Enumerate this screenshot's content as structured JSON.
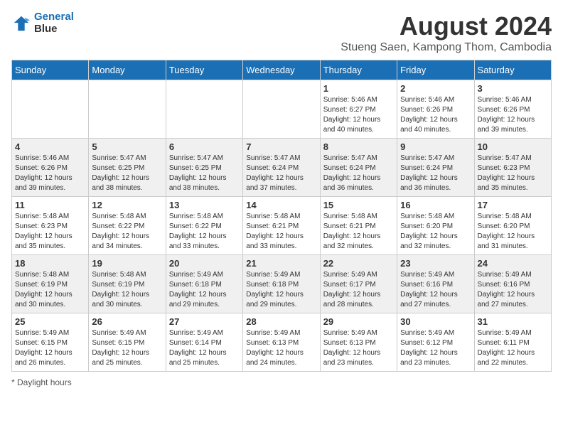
{
  "header": {
    "logo_line1": "General",
    "logo_line2": "Blue",
    "main_title": "August 2024",
    "subtitle": "Stueng Saen, Kampong Thom, Cambodia"
  },
  "days_of_week": [
    "Sunday",
    "Monday",
    "Tuesday",
    "Wednesday",
    "Thursday",
    "Friday",
    "Saturday"
  ],
  "weeks": [
    [
      {
        "day": "",
        "info": ""
      },
      {
        "day": "",
        "info": ""
      },
      {
        "day": "",
        "info": ""
      },
      {
        "day": "",
        "info": ""
      },
      {
        "day": "1",
        "info": "Sunrise: 5:46 AM\nSunset: 6:27 PM\nDaylight: 12 hours and 40 minutes."
      },
      {
        "day": "2",
        "info": "Sunrise: 5:46 AM\nSunset: 6:26 PM\nDaylight: 12 hours and 40 minutes."
      },
      {
        "day": "3",
        "info": "Sunrise: 5:46 AM\nSunset: 6:26 PM\nDaylight: 12 hours and 39 minutes."
      }
    ],
    [
      {
        "day": "4",
        "info": "Sunrise: 5:46 AM\nSunset: 6:26 PM\nDaylight: 12 hours and 39 minutes."
      },
      {
        "day": "5",
        "info": "Sunrise: 5:47 AM\nSunset: 6:25 PM\nDaylight: 12 hours and 38 minutes."
      },
      {
        "day": "6",
        "info": "Sunrise: 5:47 AM\nSunset: 6:25 PM\nDaylight: 12 hours and 38 minutes."
      },
      {
        "day": "7",
        "info": "Sunrise: 5:47 AM\nSunset: 6:24 PM\nDaylight: 12 hours and 37 minutes."
      },
      {
        "day": "8",
        "info": "Sunrise: 5:47 AM\nSunset: 6:24 PM\nDaylight: 12 hours and 36 minutes."
      },
      {
        "day": "9",
        "info": "Sunrise: 5:47 AM\nSunset: 6:24 PM\nDaylight: 12 hours and 36 minutes."
      },
      {
        "day": "10",
        "info": "Sunrise: 5:47 AM\nSunset: 6:23 PM\nDaylight: 12 hours and 35 minutes."
      }
    ],
    [
      {
        "day": "11",
        "info": "Sunrise: 5:48 AM\nSunset: 6:23 PM\nDaylight: 12 hours and 35 minutes."
      },
      {
        "day": "12",
        "info": "Sunrise: 5:48 AM\nSunset: 6:22 PM\nDaylight: 12 hours and 34 minutes."
      },
      {
        "day": "13",
        "info": "Sunrise: 5:48 AM\nSunset: 6:22 PM\nDaylight: 12 hours and 33 minutes."
      },
      {
        "day": "14",
        "info": "Sunrise: 5:48 AM\nSunset: 6:21 PM\nDaylight: 12 hours and 33 minutes."
      },
      {
        "day": "15",
        "info": "Sunrise: 5:48 AM\nSunset: 6:21 PM\nDaylight: 12 hours and 32 minutes."
      },
      {
        "day": "16",
        "info": "Sunrise: 5:48 AM\nSunset: 6:20 PM\nDaylight: 12 hours and 32 minutes."
      },
      {
        "day": "17",
        "info": "Sunrise: 5:48 AM\nSunset: 6:20 PM\nDaylight: 12 hours and 31 minutes."
      }
    ],
    [
      {
        "day": "18",
        "info": "Sunrise: 5:48 AM\nSunset: 6:19 PM\nDaylight: 12 hours and 30 minutes."
      },
      {
        "day": "19",
        "info": "Sunrise: 5:48 AM\nSunset: 6:19 PM\nDaylight: 12 hours and 30 minutes."
      },
      {
        "day": "20",
        "info": "Sunrise: 5:49 AM\nSunset: 6:18 PM\nDaylight: 12 hours and 29 minutes."
      },
      {
        "day": "21",
        "info": "Sunrise: 5:49 AM\nSunset: 6:18 PM\nDaylight: 12 hours and 29 minutes."
      },
      {
        "day": "22",
        "info": "Sunrise: 5:49 AM\nSunset: 6:17 PM\nDaylight: 12 hours and 28 minutes."
      },
      {
        "day": "23",
        "info": "Sunrise: 5:49 AM\nSunset: 6:16 PM\nDaylight: 12 hours and 27 minutes."
      },
      {
        "day": "24",
        "info": "Sunrise: 5:49 AM\nSunset: 6:16 PM\nDaylight: 12 hours and 27 minutes."
      }
    ],
    [
      {
        "day": "25",
        "info": "Sunrise: 5:49 AM\nSunset: 6:15 PM\nDaylight: 12 hours and 26 minutes."
      },
      {
        "day": "26",
        "info": "Sunrise: 5:49 AM\nSunset: 6:15 PM\nDaylight: 12 hours and 25 minutes."
      },
      {
        "day": "27",
        "info": "Sunrise: 5:49 AM\nSunset: 6:14 PM\nDaylight: 12 hours and 25 minutes."
      },
      {
        "day": "28",
        "info": "Sunrise: 5:49 AM\nSunset: 6:13 PM\nDaylight: 12 hours and 24 minutes."
      },
      {
        "day": "29",
        "info": "Sunrise: 5:49 AM\nSunset: 6:13 PM\nDaylight: 12 hours and 23 minutes."
      },
      {
        "day": "30",
        "info": "Sunrise: 5:49 AM\nSunset: 6:12 PM\nDaylight: 12 hours and 23 minutes."
      },
      {
        "day": "31",
        "info": "Sunrise: 5:49 AM\nSunset: 6:11 PM\nDaylight: 12 hours and 22 minutes."
      }
    ]
  ],
  "footer": "Daylight hours"
}
